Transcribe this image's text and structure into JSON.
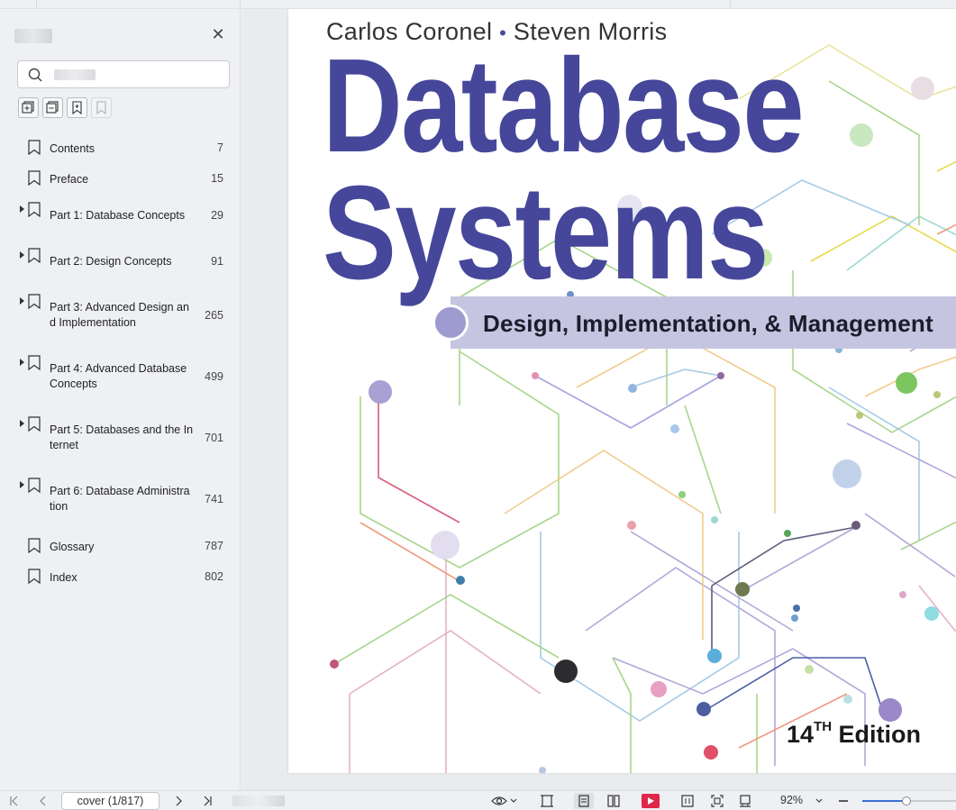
{
  "sidebar": {
    "bookmarks": [
      {
        "label": "Contents",
        "page": "7",
        "expandable": false
      },
      {
        "label": "Preface",
        "page": "15",
        "expandable": false
      },
      {
        "label": "Part 1: Database Concepts",
        "page": "29",
        "expandable": true
      },
      {
        "label": "Part 2: Design Concepts",
        "page": "91",
        "expandable": true
      },
      {
        "label": "Part 3: Advanced Design an d Implementation",
        "page": "265",
        "expandable": true
      },
      {
        "label": "Part 4: Advanced Database Concepts",
        "page": "499",
        "expandable": true
      },
      {
        "label": "Part 5: Databases and the In ternet",
        "page": "701",
        "expandable": true
      },
      {
        "label": "Part 6: Database Administra tion",
        "page": "741",
        "expandable": true
      },
      {
        "label": "Glossary",
        "page": "787",
        "expandable": false
      },
      {
        "label": "Index",
        "page": "802",
        "expandable": false
      }
    ]
  },
  "document": {
    "authors_left": "Carlos Coronel",
    "authors_sep": "•",
    "authors_right": "Steven Morris",
    "title_line1": "Database",
    "title_line2": "Systems",
    "subtitle": "Design, Implementation, & Management",
    "edition_num": "14",
    "edition_sup": "TH",
    "edition_word": " Edition"
  },
  "statusbar": {
    "page_indicator": "cover (1/817)",
    "zoom": "92%",
    "zoom_fraction": 0.47
  },
  "colors": {
    "accent_title": "#46479a",
    "subtitle_band": "#c6c5e1",
    "play_button": "#e0264b"
  }
}
